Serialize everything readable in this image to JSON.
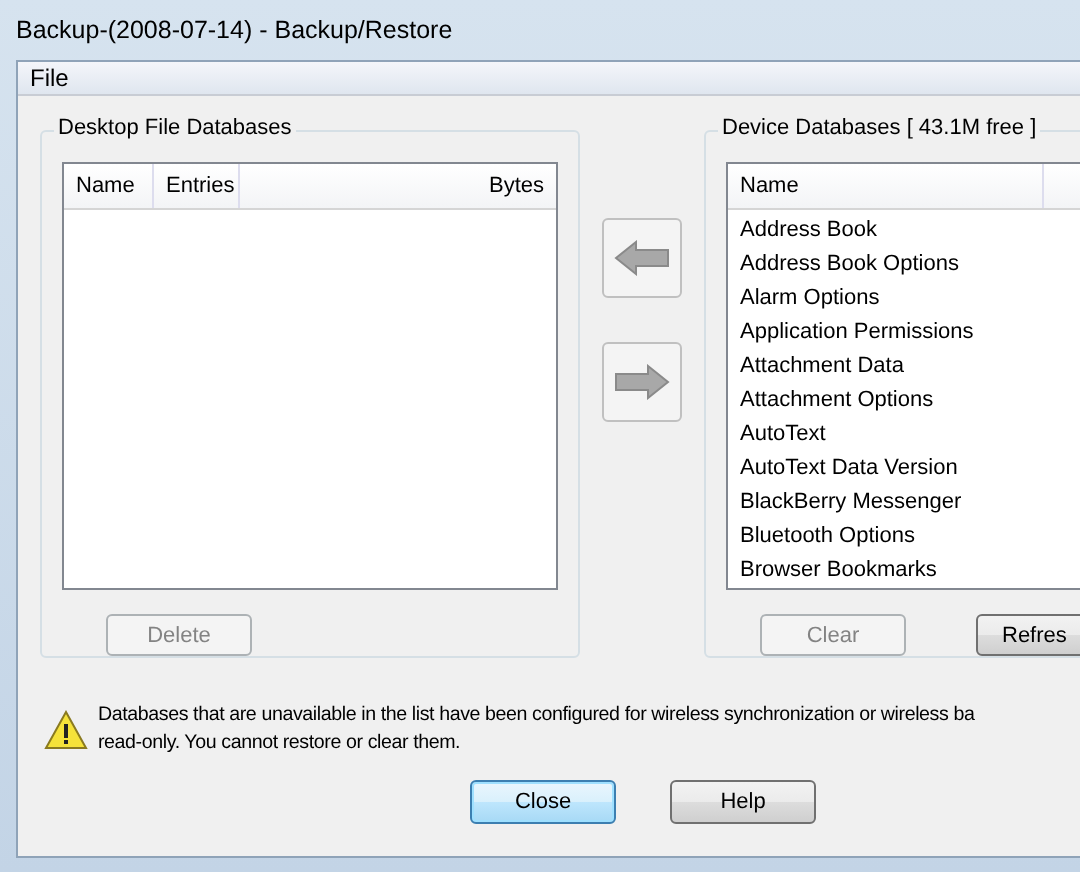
{
  "window": {
    "title": "Backup-(2008-07-14) - Backup/Restore"
  },
  "menu": [
    "File"
  ],
  "desktop": {
    "title": "Desktop File Databases",
    "columns": [
      "Name",
      "Entries",
      "Bytes"
    ],
    "delete_button": {
      "label": "Delete",
      "disabled": true
    }
  },
  "transfer": [
    {
      "kind": "left",
      "disabled": true
    },
    {
      "kind": "right",
      "disabled": true
    }
  ],
  "device": {
    "title": "Device Databases  [ 43.1M free ]",
    "columns": [
      "Name"
    ],
    "rows": [
      "Address Book",
      "Address Book Options",
      "Alarm Options",
      "Application Permissions",
      "Attachment Data",
      "Attachment Options",
      "AutoText",
      "AutoText Data Version",
      "BlackBerry Messenger",
      "Bluetooth Options",
      "Browser Bookmarks"
    ],
    "clear_button": {
      "label": "Clear",
      "disabled": true
    },
    "refresh_button": {
      "label": "Refres",
      "disabled": false
    }
  },
  "notice": {
    "lines": [
      "Databases that are unavailable in the list have been configured for wireless synchronization or wireless ba",
      "read-only. You cannot restore or clear them."
    ]
  },
  "buttons": [
    {
      "label": "Close",
      "default": true
    },
    {
      "label": "Help",
      "default": false
    }
  ]
}
